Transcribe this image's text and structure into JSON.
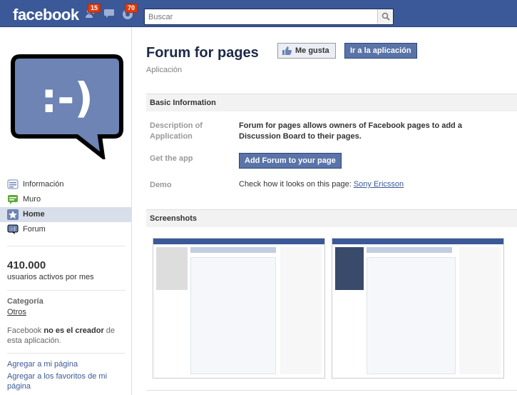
{
  "topbar": {
    "logo": "facebook",
    "search_placeholder": "Buscar",
    "badges": {
      "friends": "15",
      "messages": "",
      "notifications": "70"
    }
  },
  "page": {
    "title": "Forum for pages",
    "type": "Aplicación",
    "like_label": "Me gusta",
    "go_label": "Ir a la aplicación"
  },
  "nav": [
    {
      "label": "Información",
      "icon": "info-icon"
    },
    {
      "label": "Muro",
      "icon": "wall-icon"
    },
    {
      "label": "Home",
      "icon": "star-icon",
      "active": true
    },
    {
      "label": "Forum",
      "icon": "forum-icon"
    }
  ],
  "stats": {
    "users": "410.000",
    "users_label": "usuarios activos por mes"
  },
  "category": {
    "heading": "Categoría",
    "value": "Otros"
  },
  "disclaimer": {
    "before": "Facebook ",
    "bold": "no es el creador",
    "after": " de esta aplicación."
  },
  "links": [
    "Agregar a mi página",
    "Agregar a los favoritos de mi página"
  ],
  "basic_info": {
    "heading": "Basic Information",
    "description_label": "Description of Application",
    "description": "Forum for pages allows owners of Facebook pages to add a Discussion Board to their pages.",
    "get_app_label": "Get the app",
    "get_app_button": "Add Forum to your page",
    "demo_label": "Demo",
    "demo_text": "Check how it looks on this page: ",
    "demo_link": "Sony Ericsson"
  },
  "screenshots": {
    "heading": "Screenshots"
  },
  "colors": {
    "brand": "#3b5998",
    "badge": "#dd3c10",
    "button": "#5b74a8"
  }
}
